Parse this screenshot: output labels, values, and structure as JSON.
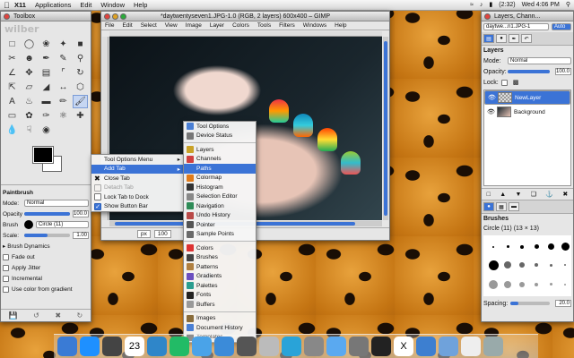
{
  "menubar": {
    "app": "X11",
    "items": [
      "Applications",
      "Edit",
      "Window",
      "Help"
    ],
    "battery": "(2:32)",
    "clock": "Wed 4:06 PM"
  },
  "toolbox": {
    "title": "Toolbox",
    "options_title": "Paintbrush",
    "mode_label": "Mode:",
    "mode_value": "Normal",
    "opacity_label": "Opacity",
    "opacity_value": "100.0",
    "opacity_level": 1.0,
    "brush_label": "Brush",
    "brush_value": "Circle (11)",
    "scale_label": "Scale:",
    "scale_value": "1.00",
    "brush_dynamics": "Brush Dynamics",
    "fade_out": "Fade out",
    "apply_jitter": "Apply Jitter",
    "incremental": "Incremental",
    "use_color": "Use color from gradient"
  },
  "image_window": {
    "title": "*daytwentyseven1.JPG-1.0 (RGB, 2 layers) 600x400 – GIMP",
    "menu": [
      "File",
      "Edit",
      "Select",
      "View",
      "Image",
      "Layer",
      "Colors",
      "Tools",
      "Filters",
      "Windows",
      "Help"
    ],
    "unit": "px",
    "zoom": "100"
  },
  "dock": {
    "title": "Layers, Chann...",
    "image_selector": "daytwe...n1.JPG-1",
    "auto_label": "Auto",
    "layers_label": "Layers",
    "mode_label": "Mode:",
    "mode_value": "Normal",
    "opacity_label": "Opacity:",
    "opacity_value": "100.0",
    "opacity_level": 1.0,
    "lock_label": "Lock:",
    "layers": [
      {
        "name": "NewLayer",
        "selected": true
      },
      {
        "name": "Background",
        "selected": false
      }
    ],
    "brushes_label": "Brushes",
    "brush_desc": "Circle (11) (13 × 13)",
    "spacing_label": "Spacing:",
    "spacing_value": "20.0",
    "spacing_level": 0.2
  },
  "context_menu": {
    "items": [
      {
        "label": "Tool Options Menu",
        "highlight": false,
        "submenu": true,
        "icon": "none"
      },
      {
        "label": "Add Tab",
        "highlight": true,
        "submenu": true,
        "icon": "none"
      },
      {
        "label": "Close Tab",
        "highlight": false,
        "submenu": false,
        "icon": "close-icon"
      },
      {
        "label": "Detach Tab",
        "highlight": false,
        "submenu": false,
        "icon": "detach-icon",
        "disabled": true
      },
      {
        "label": "Lock Tab to Dock",
        "highlight": false,
        "submenu": false,
        "icon": "checkbox-icon"
      },
      {
        "label": "Show Button Bar",
        "highlight": false,
        "submenu": false,
        "icon": "checkbox-checked-icon"
      }
    ]
  },
  "submenu": {
    "groups": [
      [
        "Tool Options",
        "Device Status"
      ],
      [
        "Layers",
        "Channels",
        "Paths",
        "Colormap",
        "Histogram",
        "Selection Editor",
        "Navigation",
        "Undo History",
        "Pointer",
        "Sample Points"
      ],
      [
        "Colors",
        "Brushes",
        "Patterns",
        "Gradients",
        "Palettes",
        "Fonts",
        "Buffers"
      ],
      [
        "Images",
        "Document History",
        "Templates"
      ]
    ],
    "highlighted": "Paths",
    "colors": {
      "Tool Options": "#4a7fd4",
      "Device Status": "#777777",
      "Layers": "#c9a227",
      "Channels": "#d04040",
      "Paths": "#3b73d6",
      "Colormap": "#e07b1a",
      "Histogram": "#333333",
      "Selection Editor": "#888888",
      "Navigation": "#2e8b57",
      "Undo History": "#b94a48",
      "Pointer": "#555555",
      "Sample Points": "#6a6a6a",
      "Colors": "#d33",
      "Brushes": "#444444",
      "Patterns": "#b08040",
      "Gradients": "#6b4fbf",
      "Palettes": "#2a9d8f",
      "Fonts": "#222222",
      "Buffers": "#999999",
      "Images": "#8a6d3b",
      "Document History": "#4a7fd4",
      "Templates": "#666666"
    }
  },
  "dockbar": {
    "icons": [
      "finder-icon",
      "appstore-icon",
      "dashboard-icon",
      "calendar-icon",
      "safari-icon",
      "timemachine-icon",
      "itunes-icon",
      "music-icon",
      "dvd-icon",
      "photo-icon",
      "network-icon",
      "camera-icon",
      "cloud-icon",
      "preview-icon",
      "terminal-icon",
      "x11-icon",
      "downloads-icon",
      "folder-icon",
      "document-icon",
      "trash-icon"
    ],
    "calendar_day": "23"
  }
}
